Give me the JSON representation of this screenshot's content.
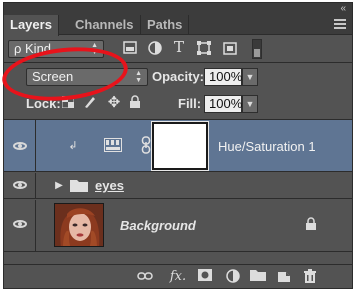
{
  "tabs": [
    "Layers",
    "Channels",
    "Paths"
  ],
  "filter": {
    "label": "ρ Kind"
  },
  "blend_mode": {
    "value": "Screen"
  },
  "opacity": {
    "label": "Opacity:",
    "value": "100%"
  },
  "lock": {
    "label": "Lock:"
  },
  "fill": {
    "label": "Fill:",
    "value": "100%"
  },
  "layers": [
    {
      "name": "Hue/Saturation 1",
      "kind": "adjustment",
      "selected": true
    },
    {
      "name": "eyes",
      "kind": "group"
    },
    {
      "name": "Background",
      "kind": "pixel",
      "locked": true
    }
  ],
  "colors": {
    "panel": "#535353",
    "selection": "#5f7593",
    "annotation": "#e8131b"
  },
  "icons": [
    "eye-icon",
    "folder-icon",
    "link-icon",
    "fx-icon",
    "mask-icon",
    "adjustment-icon",
    "new-group-icon",
    "new-layer-icon",
    "trash-icon",
    "lock-icon"
  ]
}
